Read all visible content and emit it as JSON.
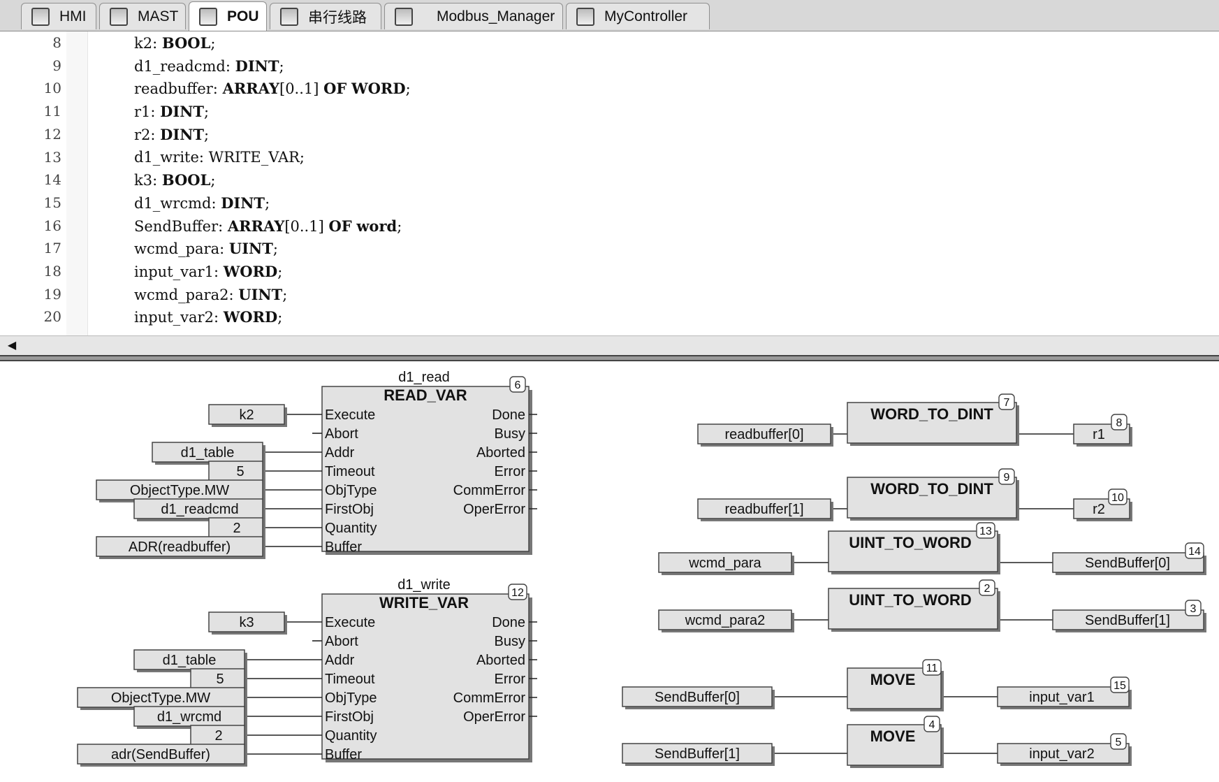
{
  "tabs": [
    {
      "label": "HMI",
      "icon": "hmi-icon"
    },
    {
      "label": "MAST",
      "icon": "task-icon"
    },
    {
      "label": "POU",
      "icon": "pou-icon",
      "active": true
    },
    {
      "label": "串行线路",
      "icon": "serial-line-icon"
    },
    {
      "label": "Modbus_Manager",
      "icon": "modbus-manager-icon"
    },
    {
      "label": "MyController",
      "icon": "controller-icon"
    }
  ],
  "code_lines": [
    {
      "n": "8",
      "name": "k2",
      "type": "BOOL",
      "type_bold": true,
      "suffix": ""
    },
    {
      "n": "9",
      "name": "d1_readcmd",
      "type": "DINT",
      "type_bold": true,
      "suffix": ""
    },
    {
      "n": "10",
      "name": "readbuffer",
      "type": "ARRAY",
      "type_bold": true,
      "suffix": "[0..1] OF WORD"
    },
    {
      "n": "11",
      "name": "r1",
      "type": "DINT",
      "type_bold": true,
      "suffix": ""
    },
    {
      "n": "12",
      "name": "r2",
      "type": "DINT",
      "type_bold": true,
      "suffix": ""
    },
    {
      "n": "13",
      "name": "d1_write",
      "type": "WRITE_VAR",
      "type_bold": false,
      "suffix": ""
    },
    {
      "n": "14",
      "name": "k3",
      "type": "BOOL",
      "type_bold": true,
      "suffix": ""
    },
    {
      "n": "15",
      "name": "d1_wrcmd",
      "type": "DINT",
      "type_bold": true,
      "suffix": ""
    },
    {
      "n": "16",
      "name": "SendBuffer",
      "type": "ARRAY",
      "type_bold": true,
      "suffix": "[0..1] OF word"
    },
    {
      "n": "17",
      "name": "wcmd_para",
      "type": "UINT",
      "type_bold": true,
      "suffix": ""
    },
    {
      "n": "18",
      "name": "input_var1",
      "type": "WORD",
      "type_bold": true,
      "suffix": ""
    },
    {
      "n": "19",
      "name": "wcmd_para2",
      "type": "UINT",
      "type_bold": true,
      "suffix": ""
    },
    {
      "n": "20",
      "name": "input_var2",
      "type": "WORD",
      "type_bold": true,
      "suffix": ""
    }
  ],
  "fbd": {
    "read_block": {
      "instance": "d1_read",
      "type": "READ_VAR",
      "number": "6",
      "inputs": [
        "Execute",
        "Abort",
        "Addr",
        "Timeout",
        "ObjType",
        "FirstObj",
        "Quantity",
        "Buffer"
      ],
      "outputs": [
        "Done",
        "Busy",
        "Aborted",
        "Error",
        "CommError",
        "OperError"
      ],
      "vars": {
        "execute": "k2",
        "addr": "d1_table",
        "timeout": "5",
        "objtype": "ObjectType.MW",
        "firstobj": "d1_readcmd",
        "quantity": "2",
        "buffer": "ADR(readbuffer)"
      }
    },
    "write_block": {
      "instance": "d1_write",
      "type": "WRITE_VAR",
      "number": "12",
      "inputs": [
        "Execute",
        "Abort",
        "Addr",
        "Timeout",
        "ObjType",
        "FirstObj",
        "Quantity",
        "Buffer"
      ],
      "outputs": [
        "Done",
        "Busy",
        "Aborted",
        "Error",
        "CommError",
        "OperError"
      ],
      "vars": {
        "execute": "k3",
        "addr": "d1_table",
        "timeout": "5",
        "objtype": "ObjectType.MW",
        "firstobj": "d1_wrcmd",
        "quantity": "2",
        "buffer": "adr(SendBuffer)"
      }
    },
    "conversions": [
      {
        "func": "WORD_TO_DINT",
        "func_no": "7",
        "input": "readbuffer[0]",
        "output": "r1",
        "out_no": "8"
      },
      {
        "func": "WORD_TO_DINT",
        "func_no": "9",
        "input": "readbuffer[1]",
        "output": "r2",
        "out_no": "10"
      },
      {
        "func": "UINT_TO_WORD",
        "func_no": "13",
        "input": "wcmd_para",
        "output": "SendBuffer[0]",
        "out_no": "14"
      },
      {
        "func": "UINT_TO_WORD",
        "func_no": "2",
        "input": "wcmd_para2",
        "output": "SendBuffer[1]",
        "out_no": "3"
      },
      {
        "func": "MOVE",
        "func_no": "11",
        "input": "SendBuffer[0]",
        "output": "input_var1",
        "out_no": "15"
      },
      {
        "func": "MOVE",
        "func_no": "4",
        "input": "SendBuffer[1]",
        "output": "input_var2",
        "out_no": "5"
      }
    ]
  }
}
